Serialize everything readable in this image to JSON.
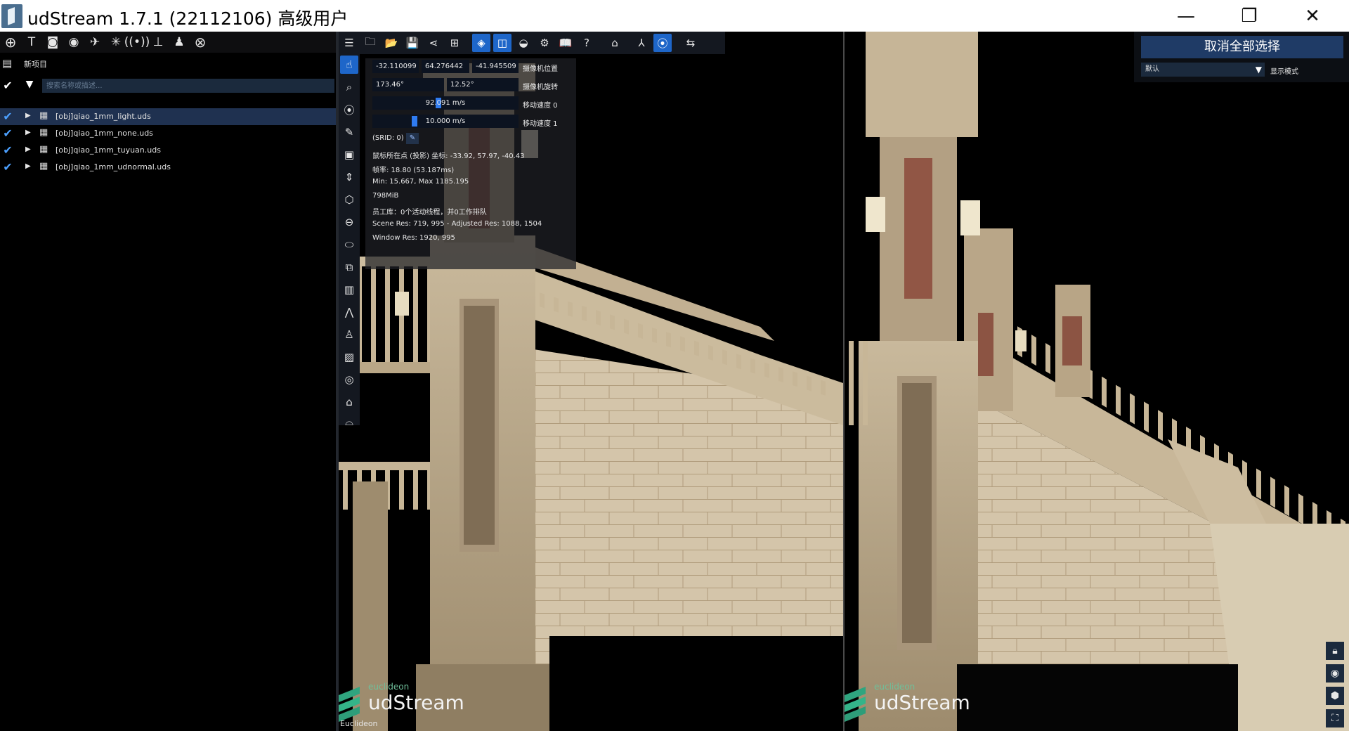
{
  "titlebar": {
    "title": "udStream 1.7.1 (22112106) 高级用户",
    "minimize_icon": "—",
    "maximize_icon": "❐",
    "close_icon": "✕"
  },
  "left_panel": {
    "toolbar_icons": [
      "add-icon",
      "text-icon",
      "camera-icon",
      "camera-viewpoint-icon",
      "flythrough-icon",
      "network-icon",
      "broadcast-icon",
      "stamp-icon",
      "person-pin-icon",
      "cancel-icon"
    ],
    "project_label": "新项目",
    "search_placeholder": "搜索名称或描述...",
    "items": [
      {
        "label": "[obj]qiao_1mm_light.uds",
        "selected": true
      },
      {
        "label": "[obj]qiao_1mm_none.uds",
        "selected": false
      },
      {
        "label": "[obj]qiao_1mm_tuyuan.uds",
        "selected": false
      },
      {
        "label": "[obj]qiao_1mm_udnormal.uds",
        "selected": false
      }
    ]
  },
  "camera": {
    "pos_x": "-32.110099",
    "pos_y": "64.276442",
    "pos_z": "-41.945509",
    "position_label": "摄像机位置",
    "rot_heading": "173.46°",
    "rot_pitch": "12.52°",
    "rotation_label": "摄像机旋转",
    "speed0_value": "92.091 m/s",
    "speed0_label": "移动速度 0",
    "speed0_level": 0.45,
    "speed1_value": "10.000 m/s",
    "speed1_label": "移动速度 1",
    "speed1_level": 0.28,
    "srid": "(SRID: 0)",
    "srid_edit_icon": "✎"
  },
  "info": {
    "mouse_pos": "鼠标所在点 (投影) 坐标: -33.92, 57.97, -40.43",
    "frame_rate": "帧率: 18.80 (53.187ms)",
    "min_max": "Min: 15.667, Max 1185.195",
    "memory": "798MiB",
    "workers": "员工库：0个活动线程，并0工作排队",
    "scene_res": "Scene Res: 719, 995 - Adjusted Res: 1088, 1504",
    "window_res": "Window Res: 1920, 995"
  },
  "right_panel": {
    "deselect_all": "取消全部选择",
    "mode_value": "默认",
    "mode_label": "显示模式"
  },
  "logo": {
    "small": "euclideon",
    "big": "udStream"
  },
  "footer": {
    "euclideon": "Euclideon"
  },
  "colors": {
    "accent": "#1e66c9",
    "check": "#4ca0ff",
    "panel_bg": "#141820",
    "selected_row": "#1f3150"
  }
}
